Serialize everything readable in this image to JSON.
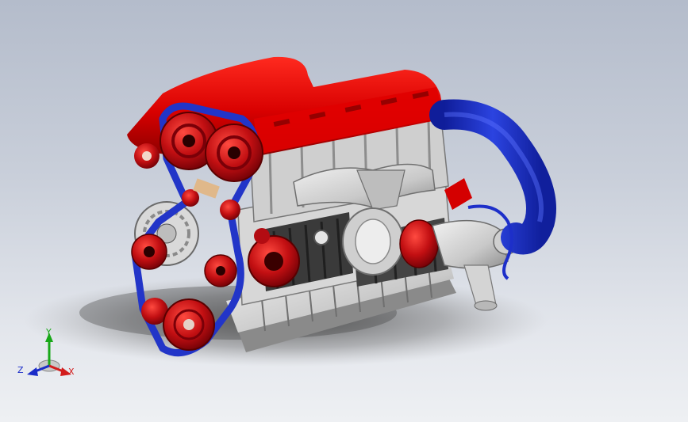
{
  "viewport": {
    "background_top": "#b4bccb",
    "background_bottom": "#eef0f3"
  },
  "model": {
    "colors": {
      "valve_cover": "#dc0000",
      "intake_pipe": "#1d2fc9",
      "belt": "#2235c8",
      "pulley": "#c80e18",
      "casting": "#d6d6d6",
      "block_dark": "#3a3a3a"
    }
  },
  "triad": {
    "x_label": "X",
    "y_label": "Y",
    "z_label": "Z",
    "x_color": "#d21c1c",
    "y_color": "#18a818",
    "z_color": "#1a2cc8"
  }
}
